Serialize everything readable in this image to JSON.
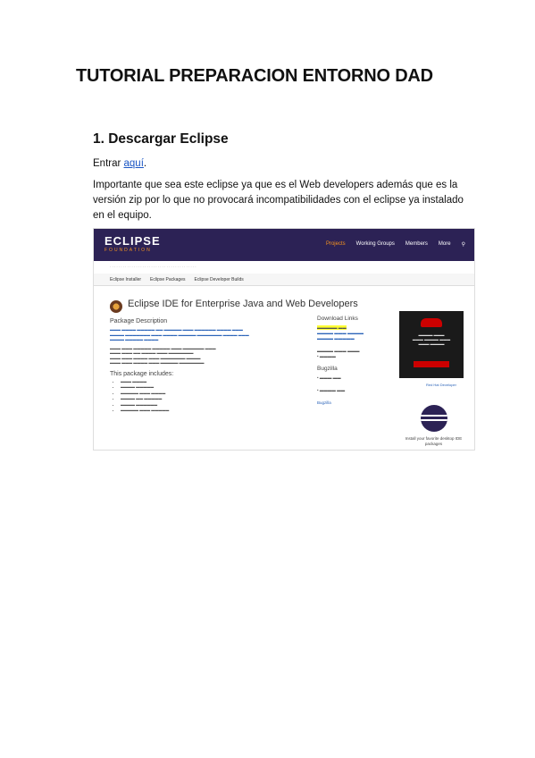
{
  "document": {
    "title": "TUTORIAL PREPARACION ENTORNO DAD",
    "section_heading": "1. Descargar Eclipse",
    "p1_prefix": "Entrar ",
    "p1_link": "aquí",
    "p1_suffix": ".",
    "p2": "Importante que sea este eclipse ya que es el Web developers además que es la versión zip por lo que no provocará incompatibilidades con el eclipse ya instalado en el equipo."
  },
  "screenshot": {
    "logo_main": "ECLIPSE",
    "logo_sub": "FOUNDATION",
    "nav": [
      "Projects",
      "Working Groups",
      "Members",
      "More"
    ],
    "subtabs": [
      "Eclipse Installer",
      "Eclipse Packages",
      "Eclipse Developer Builds"
    ],
    "package_title": "Eclipse IDE for Enterprise Java and Web Developers",
    "package_description_heading": "Package Description",
    "includes_heading": "This package includes:",
    "download_links_heading": "Download Links",
    "bugzilla_heading": "Bugzilla",
    "bugzilla_link": "Bugzilla",
    "ad_caption": "Red Hat Developer",
    "install_caption": "Install your favorite desktop IDE packages"
  },
  "colors": {
    "eclipse_header": "#2c2255",
    "eclipse_accent": "#f7941e",
    "link": "#1a55c4",
    "highlight": "#ffff33"
  }
}
